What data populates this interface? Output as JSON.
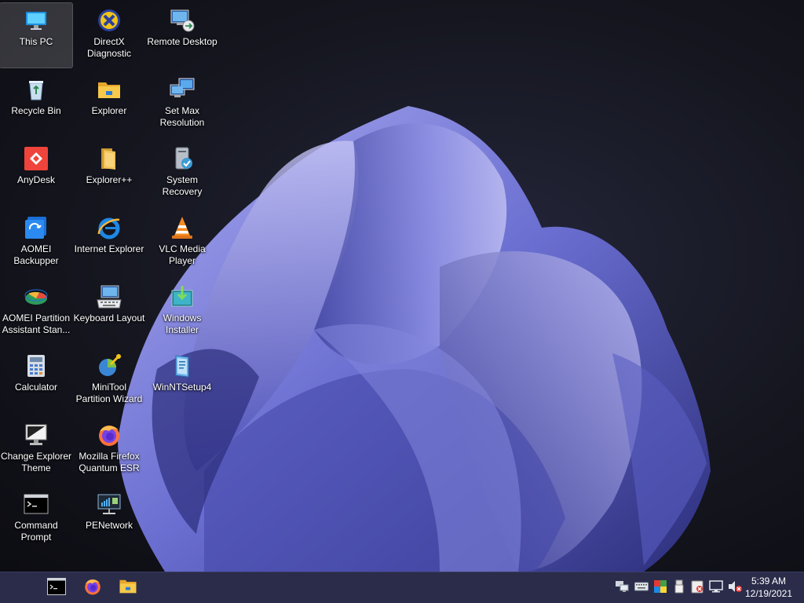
{
  "desktop": {
    "icons": [
      {
        "label": "This PC",
        "icon": "monitor-icon",
        "selected": true
      },
      {
        "label": "Recycle Bin",
        "icon": "recycle-bin-icon"
      },
      {
        "label": "AnyDesk",
        "icon": "anydesk-icon"
      },
      {
        "label": "AOMEI\nBackupper",
        "icon": "aomei-backupper-icon"
      },
      {
        "label": "AOMEI Partition\nAssistant Stan...",
        "icon": "aomei-partition-icon"
      },
      {
        "label": "Calculator",
        "icon": "calculator-icon"
      },
      {
        "label": "Change Explorer\nTheme",
        "icon": "theme-monitor-icon"
      },
      {
        "label": "Command\nPrompt",
        "icon": "command-prompt-icon"
      },
      {
        "label": "DirectX\nDiagnostic",
        "icon": "directx-icon"
      },
      {
        "label": "Explorer",
        "icon": "folder-icon"
      },
      {
        "label": "Explorer++",
        "icon": "folder-plus-icon"
      },
      {
        "label": "Internet Explorer",
        "icon": "internet-explorer-icon"
      },
      {
        "label": "Keyboard Layout",
        "icon": "keyboard-icon"
      },
      {
        "label": "MiniTool\nPartition Wizard",
        "icon": "minitool-icon"
      },
      {
        "label": "Mozilla Firefox\nQuantum ESR",
        "icon": "firefox-icon"
      },
      {
        "label": "PENetwork",
        "icon": "network-icon"
      },
      {
        "label": "Remote Desktop",
        "icon": "remote-desktop-icon"
      },
      {
        "label": "Set Max\nResolution",
        "icon": "resolution-icon"
      },
      {
        "label": "System Recovery",
        "icon": "system-recovery-icon"
      },
      {
        "label": "VLC Media\nPlayer",
        "icon": "vlc-icon"
      },
      {
        "label": "Windows\nInstaller",
        "icon": "windows-installer-icon"
      },
      {
        "label": "WinNTSetup4",
        "icon": "winntsetup-icon"
      }
    ]
  },
  "taskbar": {
    "pinned": [
      "command-prompt-icon",
      "firefox-icon",
      "file-explorer-icon"
    ],
    "tray": [
      "network-icon",
      "keyboard-icon",
      "color-icon",
      "usb-icon",
      "security-icon",
      "display-icon",
      "volume-muted-icon"
    ],
    "clock": {
      "time": "5:39 AM",
      "date": "12/19/2021"
    }
  },
  "colors": {
    "taskbar": "#2a2c4a",
    "accent": "#6b6fd0"
  }
}
